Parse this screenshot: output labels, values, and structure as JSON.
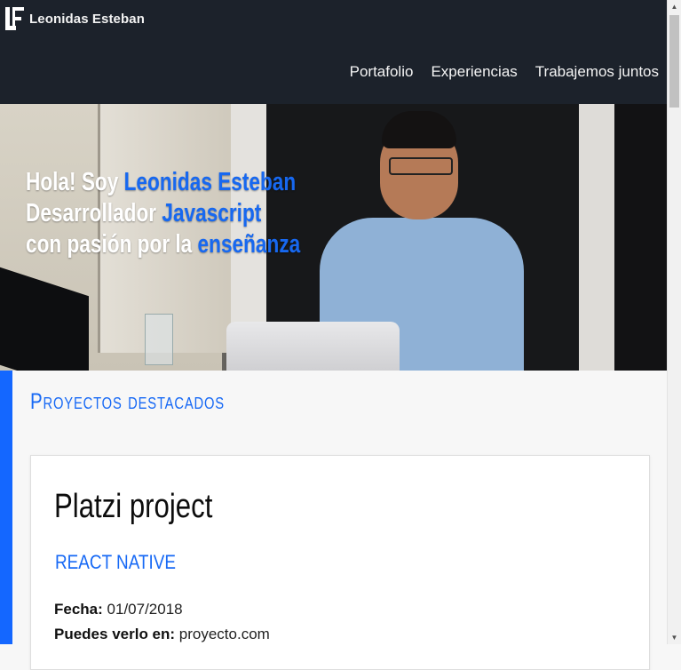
{
  "header": {
    "brand": "Leonidas Esteban",
    "nav": [
      "Portafolio",
      "Experiencias",
      "Trabajemos juntos"
    ]
  },
  "hero": {
    "line1": [
      "Hola! Soy ",
      "Leonidas Esteban"
    ],
    "line2": [
      "Desarrollador ",
      "Javascript"
    ],
    "line3": [
      "con pasión por la ",
      "enseñanza"
    ]
  },
  "projects": {
    "title": "Proyectos destacados",
    "card": {
      "title": "Platzi project",
      "tag": "React Native",
      "date_label": "Fecha:",
      "date_value": "01/07/2018",
      "link_label": "Puedes verlo en:",
      "link_value": "proyecto.com"
    }
  },
  "colors": {
    "accent": "#1467ff",
    "header_bg": "#1c222b"
  },
  "icons": [
    "logo-icon",
    "scroll-up-arrow-icon",
    "scroll-down-arrow-icon"
  ]
}
